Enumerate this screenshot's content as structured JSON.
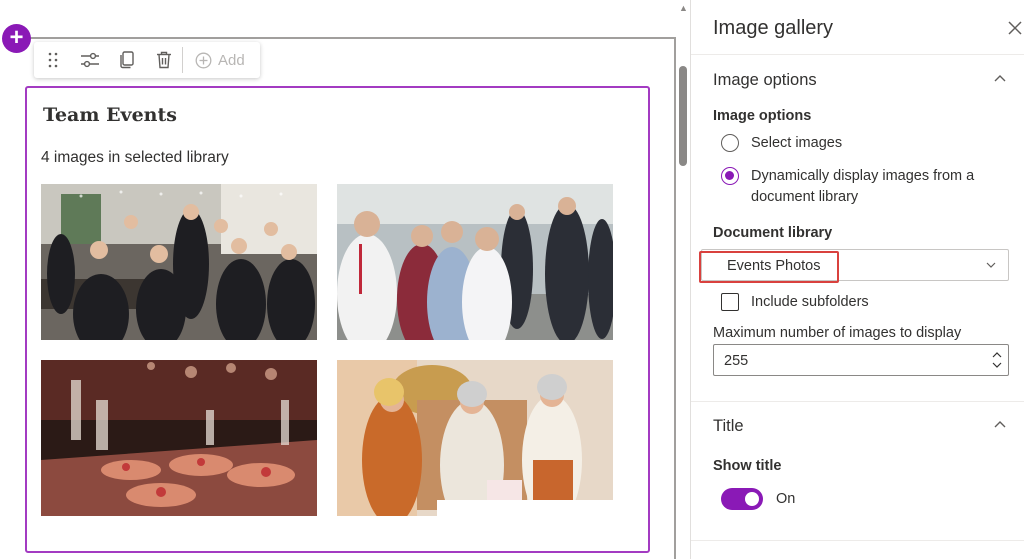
{
  "toolbar": {
    "add_label": "Add",
    "icons": [
      "drag-handle-icon",
      "edit-properties-icon",
      "duplicate-icon",
      "delete-icon",
      "add-circle-icon"
    ]
  },
  "webpart": {
    "title": "Team Events",
    "count_text": "4 images in selected library",
    "images": [
      {
        "name": "gallery-image-party-toast"
      },
      {
        "name": "gallery-image-networking"
      },
      {
        "name": "gallery-image-buffet"
      },
      {
        "name": "gallery-image-celebration"
      }
    ]
  },
  "pane": {
    "title": "Image gallery",
    "image_options_group": "Image options",
    "image_options_label": "Image options",
    "radio_select": "Select images",
    "radio_dynamic": "Dynamically display images from a document library",
    "doclib_label": "Document library",
    "doclib_value": "Events Photos",
    "include_subfolders": "Include subfolders",
    "max_label": "Maximum number of images to display",
    "max_value": "255",
    "title_group": "Title",
    "show_title_label": "Show title",
    "toggle_text": "On"
  },
  "colors": {
    "accent": "#8a19b6",
    "highlight": "#d9413e",
    "selection_border": "#a33bc2"
  }
}
